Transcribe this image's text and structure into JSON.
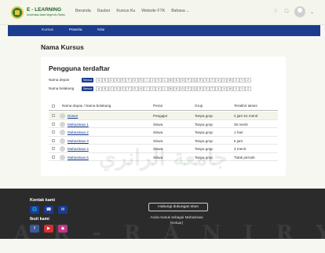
{
  "brand": {
    "name": "E - LEARNING",
    "tagline": "Universitas Islam Negeri Ar-Raniry"
  },
  "nav": {
    "items": [
      "Beranda",
      "Dasbor",
      "Kursus Ku",
      "Website FTK"
    ],
    "dropdown": "Bahasa"
  },
  "tabs": [
    {
      "label": "Kursus",
      "active": false
    },
    {
      "label": "Peserta",
      "active": true
    },
    {
      "label": "Nilai",
      "active": false
    }
  ],
  "course_title": "Nama Kursus",
  "section_title": "Pengguna terdaftar",
  "filters": {
    "first_name": {
      "label": "Nama depan",
      "chip": "Semua",
      "letters": [
        "A",
        "B",
        "C",
        "D",
        "E",
        "F",
        "G",
        "H",
        "I",
        "J",
        "K",
        "L",
        "M",
        "N",
        "O",
        "P",
        "Q",
        "R",
        "S",
        "T",
        "U",
        "V",
        "W",
        "X",
        "Y",
        "Z"
      ]
    },
    "last_name": {
      "label": "Nama belakang",
      "chip": "Semua",
      "letters": [
        "A",
        "B",
        "C",
        "D",
        "E",
        "F",
        "G",
        "H",
        "I",
        "J",
        "K",
        "L",
        "M",
        "N",
        "O",
        "P",
        "Q",
        "R",
        "S",
        "T",
        "U",
        "V",
        "W",
        "X",
        "Y",
        "Z"
      ]
    }
  },
  "table": {
    "headers": [
      "Nama depan / Nama belakang",
      "Peran",
      "Grup",
      "Terakhir akses"
    ],
    "rows": [
      {
        "name": "Dosen",
        "role": "Pengajar",
        "group": "Tanpa grup",
        "last": "2 jam 51 menit"
      },
      {
        "name": "Mahasiswa 1",
        "role": "Siswa",
        "group": "Tanpa grup",
        "last": "26 menit"
      },
      {
        "name": "Mahasiswa 2",
        "role": "Siswa",
        "group": "Tanpa grup",
        "last": "1 hari"
      },
      {
        "name": "Mahasiswa 3",
        "role": "Siswa",
        "group": "Tanpa grup",
        "last": "5 jam"
      },
      {
        "name": "Mahasiswa 4",
        "role": "Siswa",
        "group": "Tanpa grup",
        "last": "3 menit"
      },
      {
        "name": "Mahasiswa 5",
        "role": "Siswa",
        "group": "Tanpa grup",
        "last": "Tidak pernah"
      }
    ]
  },
  "footer": {
    "contact_title": "Kontak kami",
    "follow_title": "Ikuti kami",
    "help_button": "Hubungi dukungan situs",
    "login_line1": "Anda masuk sebagai Mahasiswa",
    "login_line2": "(Keluar)"
  },
  "icons": {
    "contact": [
      "globe-icon",
      "phone-icon",
      "mail-icon"
    ],
    "social": [
      "facebook-icon",
      "youtube-icon",
      "instagram-icon"
    ]
  },
  "colors": {
    "primary": "#1b3c8f",
    "brand_green": "#2f7d32",
    "footer": "#2b2b2b",
    "youtube": "#d32f2f",
    "instagram": "#c13584",
    "facebook": "#3b5998"
  }
}
